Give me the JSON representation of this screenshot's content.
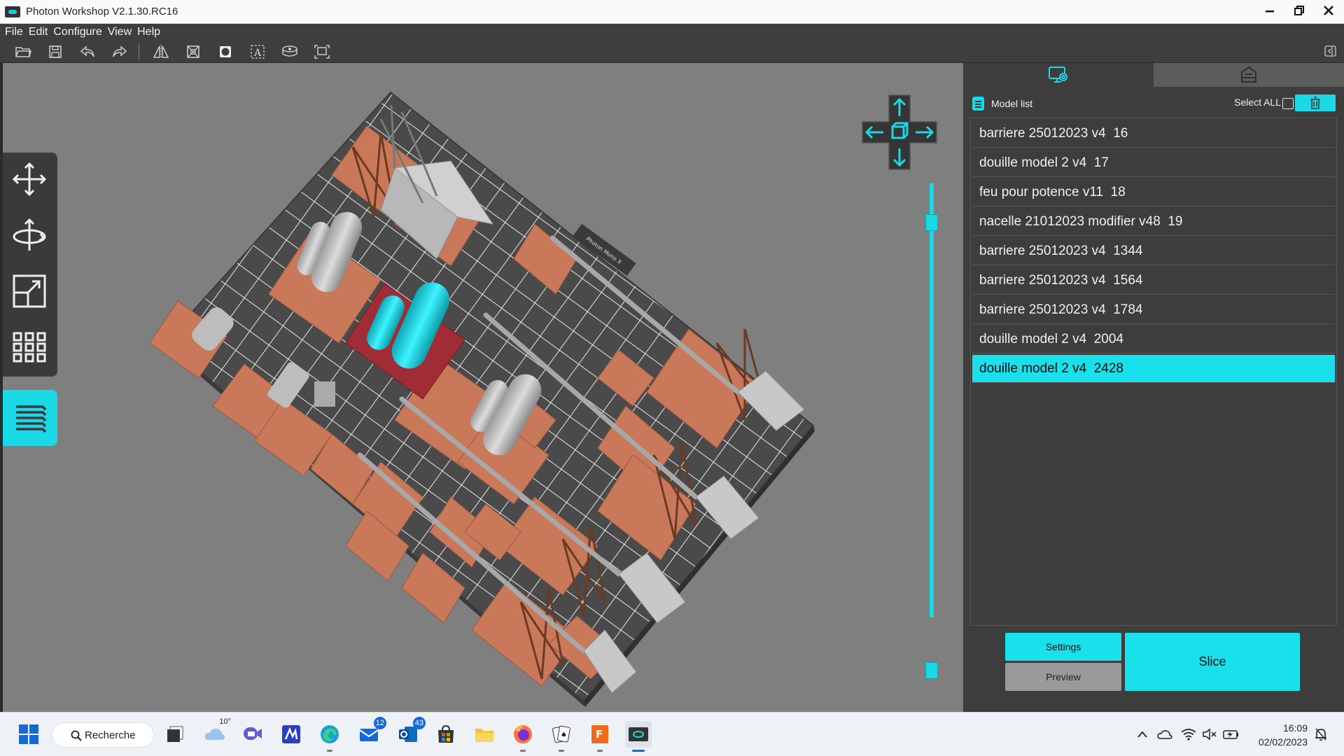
{
  "app": {
    "title": "Photon Workshop V2.1.30.RC16",
    "window_controls": [
      "minimize",
      "restore",
      "close"
    ]
  },
  "menu": [
    "File",
    "Edit",
    "Configure",
    "View",
    "Help"
  ],
  "toolbar": {
    "tools": [
      "open-folder-icon",
      "save-icon",
      "undo-icon",
      "redo-icon",
      "mirror-icon",
      "hollow-icon",
      "punch-hole-icon",
      "text-icon",
      "base-icon",
      "supports-icon"
    ]
  },
  "left_tools": [
    "move-icon",
    "rotate-icon",
    "scale-icon",
    "arrange-icon",
    "layers-icon"
  ],
  "model_list": {
    "title": "Model list",
    "select_all_label": "Select ALL",
    "select_all_checked": false,
    "items": [
      {
        "name": "barriere 25012023 v4  16",
        "selected": false
      },
      {
        "name": "douille model 2 v4  17",
        "selected": false
      },
      {
        "name": "feu pour potence v11  18",
        "selected": false
      },
      {
        "name": "nacelle 21012023 modifier v48  19",
        "selected": false
      },
      {
        "name": "barriere 25012023 v4  1344",
        "selected": false
      },
      {
        "name": "barriere 25012023 v4  1564",
        "selected": false
      },
      {
        "name": "barriere 25012023 v4  1784",
        "selected": false
      },
      {
        "name": "douille model 2 v4  2004",
        "selected": false
      },
      {
        "name": "douille model 2 v4  2428",
        "selected": true
      }
    ]
  },
  "buttons": {
    "settings": "Settings",
    "preview": "Preview",
    "slice": "Slice"
  },
  "plate_label": "Photon Mono X",
  "taskbar": {
    "search_label": "Recherche",
    "weather_temp": "10°",
    "mail_badge": "12",
    "outlook_badge": "43",
    "time": "16:09",
    "date": "02/02/2023"
  },
  "colors": {
    "accent": "#1ae0ec",
    "panel": "#3d3d3d",
    "viewport": "#7f7f7f",
    "plate": "#4a4a4a",
    "support_raft": "#c9785a",
    "selected_raft": "#a02c36"
  }
}
